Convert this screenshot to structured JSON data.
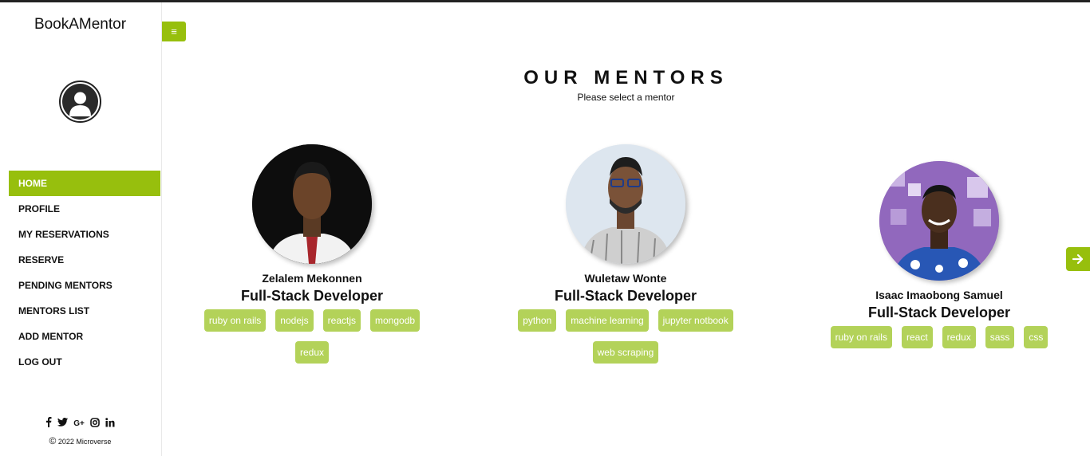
{
  "app": {
    "brand": "BookAMentor"
  },
  "sidebar": {
    "items": [
      {
        "label": "HOME",
        "active": true
      },
      {
        "label": "PROFILE"
      },
      {
        "label": "MY RESERVATIONS"
      },
      {
        "label": "RESERVE"
      },
      {
        "label": "PENDING MENTORS"
      },
      {
        "label": "MENTORS LIST"
      },
      {
        "label": "ADD MENTOR"
      },
      {
        "label": "LOG OUT"
      }
    ],
    "social_icons": [
      "facebook-icon",
      "twitter-icon",
      "google-plus-icon",
      "instagram-icon",
      "linkedin-icon"
    ],
    "copyright": "2022 Microverse"
  },
  "main": {
    "title": "OUR MENTORS",
    "subtitle": "Please select a mentor",
    "mentors": [
      {
        "name": "Zelalem Mekonnen",
        "role": "Full-Stack Developer",
        "skills": [
          "ruby on rails",
          "nodejs",
          "reactjs",
          "mongodb",
          "redux"
        ]
      },
      {
        "name": "Wuletaw Wonte",
        "role": "Full-Stack Developer",
        "skills": [
          "python",
          "machine learning",
          "jupyter notbook",
          "web scraping"
        ]
      },
      {
        "name": "Isaac Imaobong Samuel",
        "role": "Full-Stack Developer",
        "skills": [
          "ruby on rails",
          "react",
          "redux",
          "sass",
          "css"
        ]
      }
    ]
  },
  "colors": {
    "accent": "#97bf0d",
    "tag": "#b3d259"
  }
}
